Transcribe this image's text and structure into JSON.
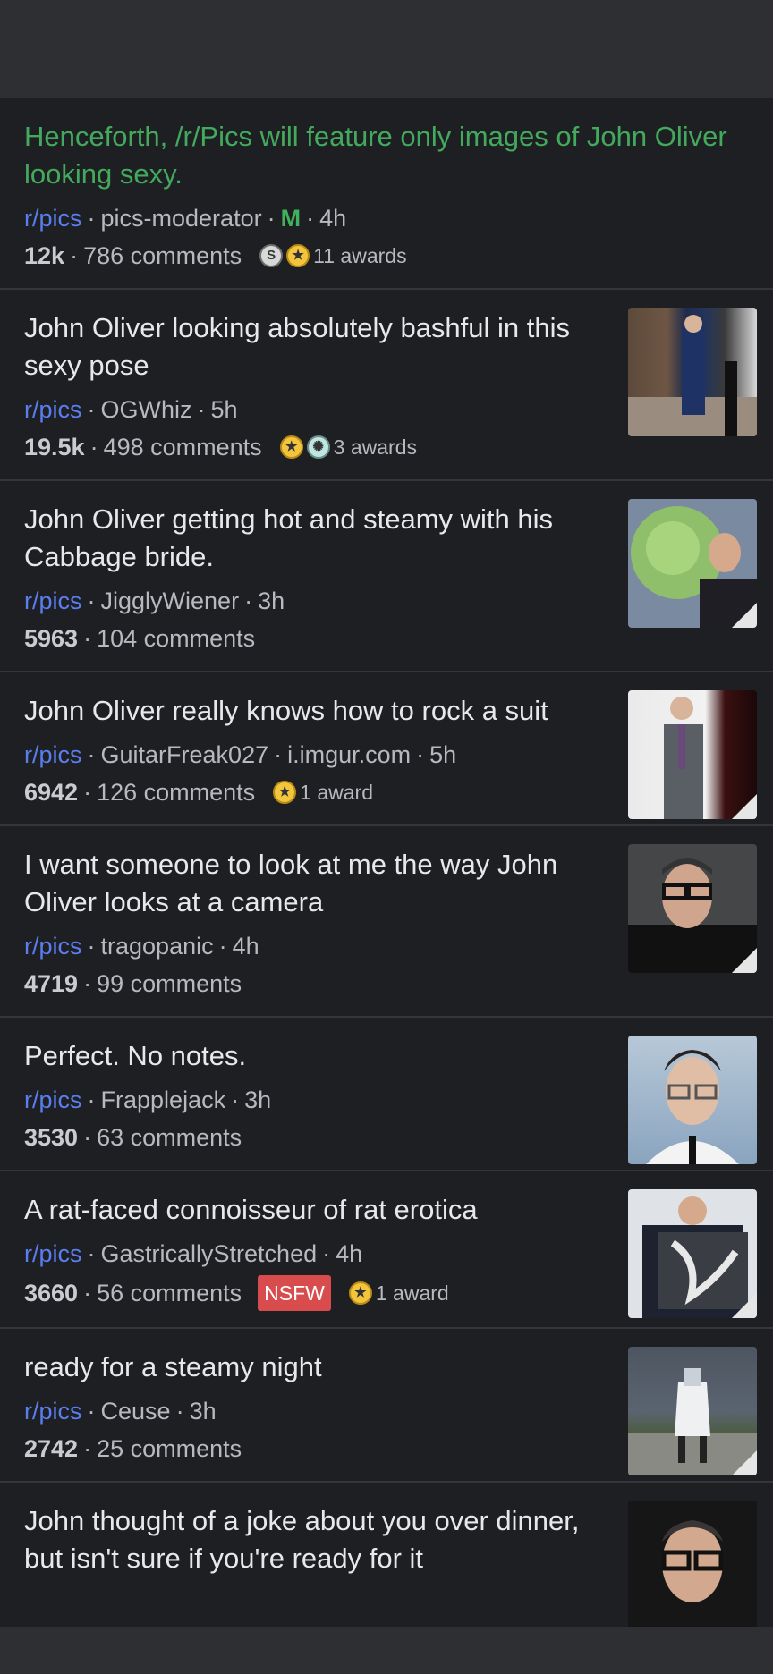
{
  "posts": [
    {
      "title": "Henceforth, /r/Pics will feature only images of John Oliver looking sexy.",
      "subreddit": "r/pics",
      "author": "pics-moderator",
      "mod_badge": "M",
      "age": "4h",
      "score": "12k",
      "comments": "786 comments",
      "awards_label": "11 awards"
    },
    {
      "title": "John Oliver looking absolutely bashful in this sexy pose",
      "subreddit": "r/pics",
      "author": "OGWhiz",
      "age": "5h",
      "score": "19.5k",
      "comments": "498 comments",
      "awards_label": "3 awards"
    },
    {
      "title": "John Oliver getting hot and steamy with his Cabbage bride.",
      "subreddit": "r/pics",
      "author": "JigglyWiener",
      "age": "3h",
      "score": "5963",
      "comments": "104 comments"
    },
    {
      "title": "John Oliver really knows how to rock a suit",
      "subreddit": "r/pics",
      "author": "GuitarFreak027",
      "domain": "i.imgur.com",
      "age": "5h",
      "score": "6942",
      "comments": "126 comments",
      "awards_label": "1 award"
    },
    {
      "title": "I want someone to look at me the way John Oliver looks at a camera",
      "subreddit": "r/pics",
      "author": "tragopanic",
      "age": "4h",
      "score": "4719",
      "comments": "99 comments"
    },
    {
      "title": "Perfect. No notes.",
      "subreddit": "r/pics",
      "author": "Frapplejack",
      "age": "3h",
      "score": "3530",
      "comments": "63 comments"
    },
    {
      "title": "A rat-faced connoisseur of rat erotica",
      "subreddit": "r/pics",
      "author": "GastricallyStretched",
      "age": "4h",
      "score": "3660",
      "comments": "56 comments",
      "nsfw": "NSFW",
      "awards_label": "1 award"
    },
    {
      "title": "ready for a steamy night",
      "subreddit": "r/pics",
      "author": "Ceuse",
      "age": "3h",
      "score": "2742",
      "comments": "25 comments"
    },
    {
      "title": "John thought of a joke about you over dinner, but isn't sure if you're ready for it"
    }
  ],
  "colors": {
    "background": "#1e1f23",
    "bar": "#2d2f33",
    "subreddit": "#5a7ef0",
    "mod": "#43a95d",
    "nsfw": "#d84c4e"
  },
  "icons": {
    "silver_award": "silver-award-icon",
    "gold_award": "gold-award-icon",
    "wholesome_award": "wholesome-award-icon"
  }
}
